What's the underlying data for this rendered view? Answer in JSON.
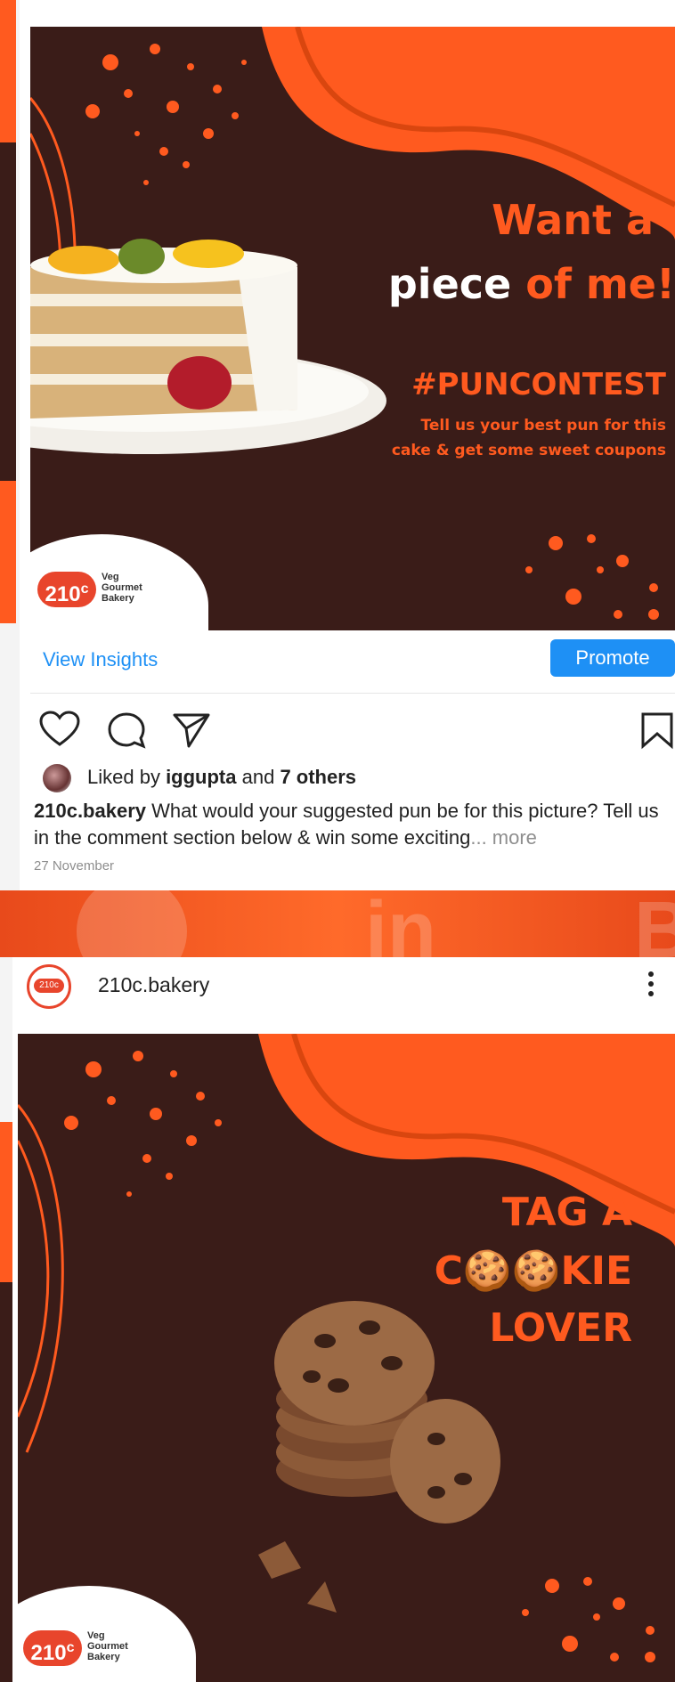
{
  "post1": {
    "headline_line1": "Want a",
    "headline_piece": "piece",
    "headline_ofme": "of me!",
    "hashtag": "#PUNCONTEST",
    "subtext_line1": "Tell us your best pun for this",
    "subtext_line2": "cake & get some sweet coupons",
    "logo_number": "210",
    "logo_degree": "c",
    "logo_line1": "Veg",
    "logo_line2": "Gourmet",
    "logo_line3": "Bakery",
    "view_insights": "View Insights",
    "promote": "Promote",
    "liked_prefix": "Liked by ",
    "liked_user": "iggupta",
    "liked_and": " and ",
    "liked_others": "7 others",
    "caption_user": "210c.bakery",
    "caption_text": " What would your suggested pun be for this picture? Tell us in the comment section below & win some exciting",
    "caption_more": "... more",
    "date": "27 November"
  },
  "post2": {
    "username": "210c.bakery",
    "avatar_text": "210c",
    "line1": "TAG A",
    "line2": "C🍪🍪KIE",
    "line3": "LOVER",
    "logo_number": "210",
    "logo_degree": "c",
    "logo_line1": "Veg",
    "logo_line2": "Gourmet",
    "logo_line3": "Bakery"
  },
  "between": {
    "watermark_in": "in",
    "watermark_b": "B"
  },
  "colors": {
    "orange": "#ff5a1f",
    "brown": "#3a1c18",
    "blue_link": "#1e90f5"
  }
}
